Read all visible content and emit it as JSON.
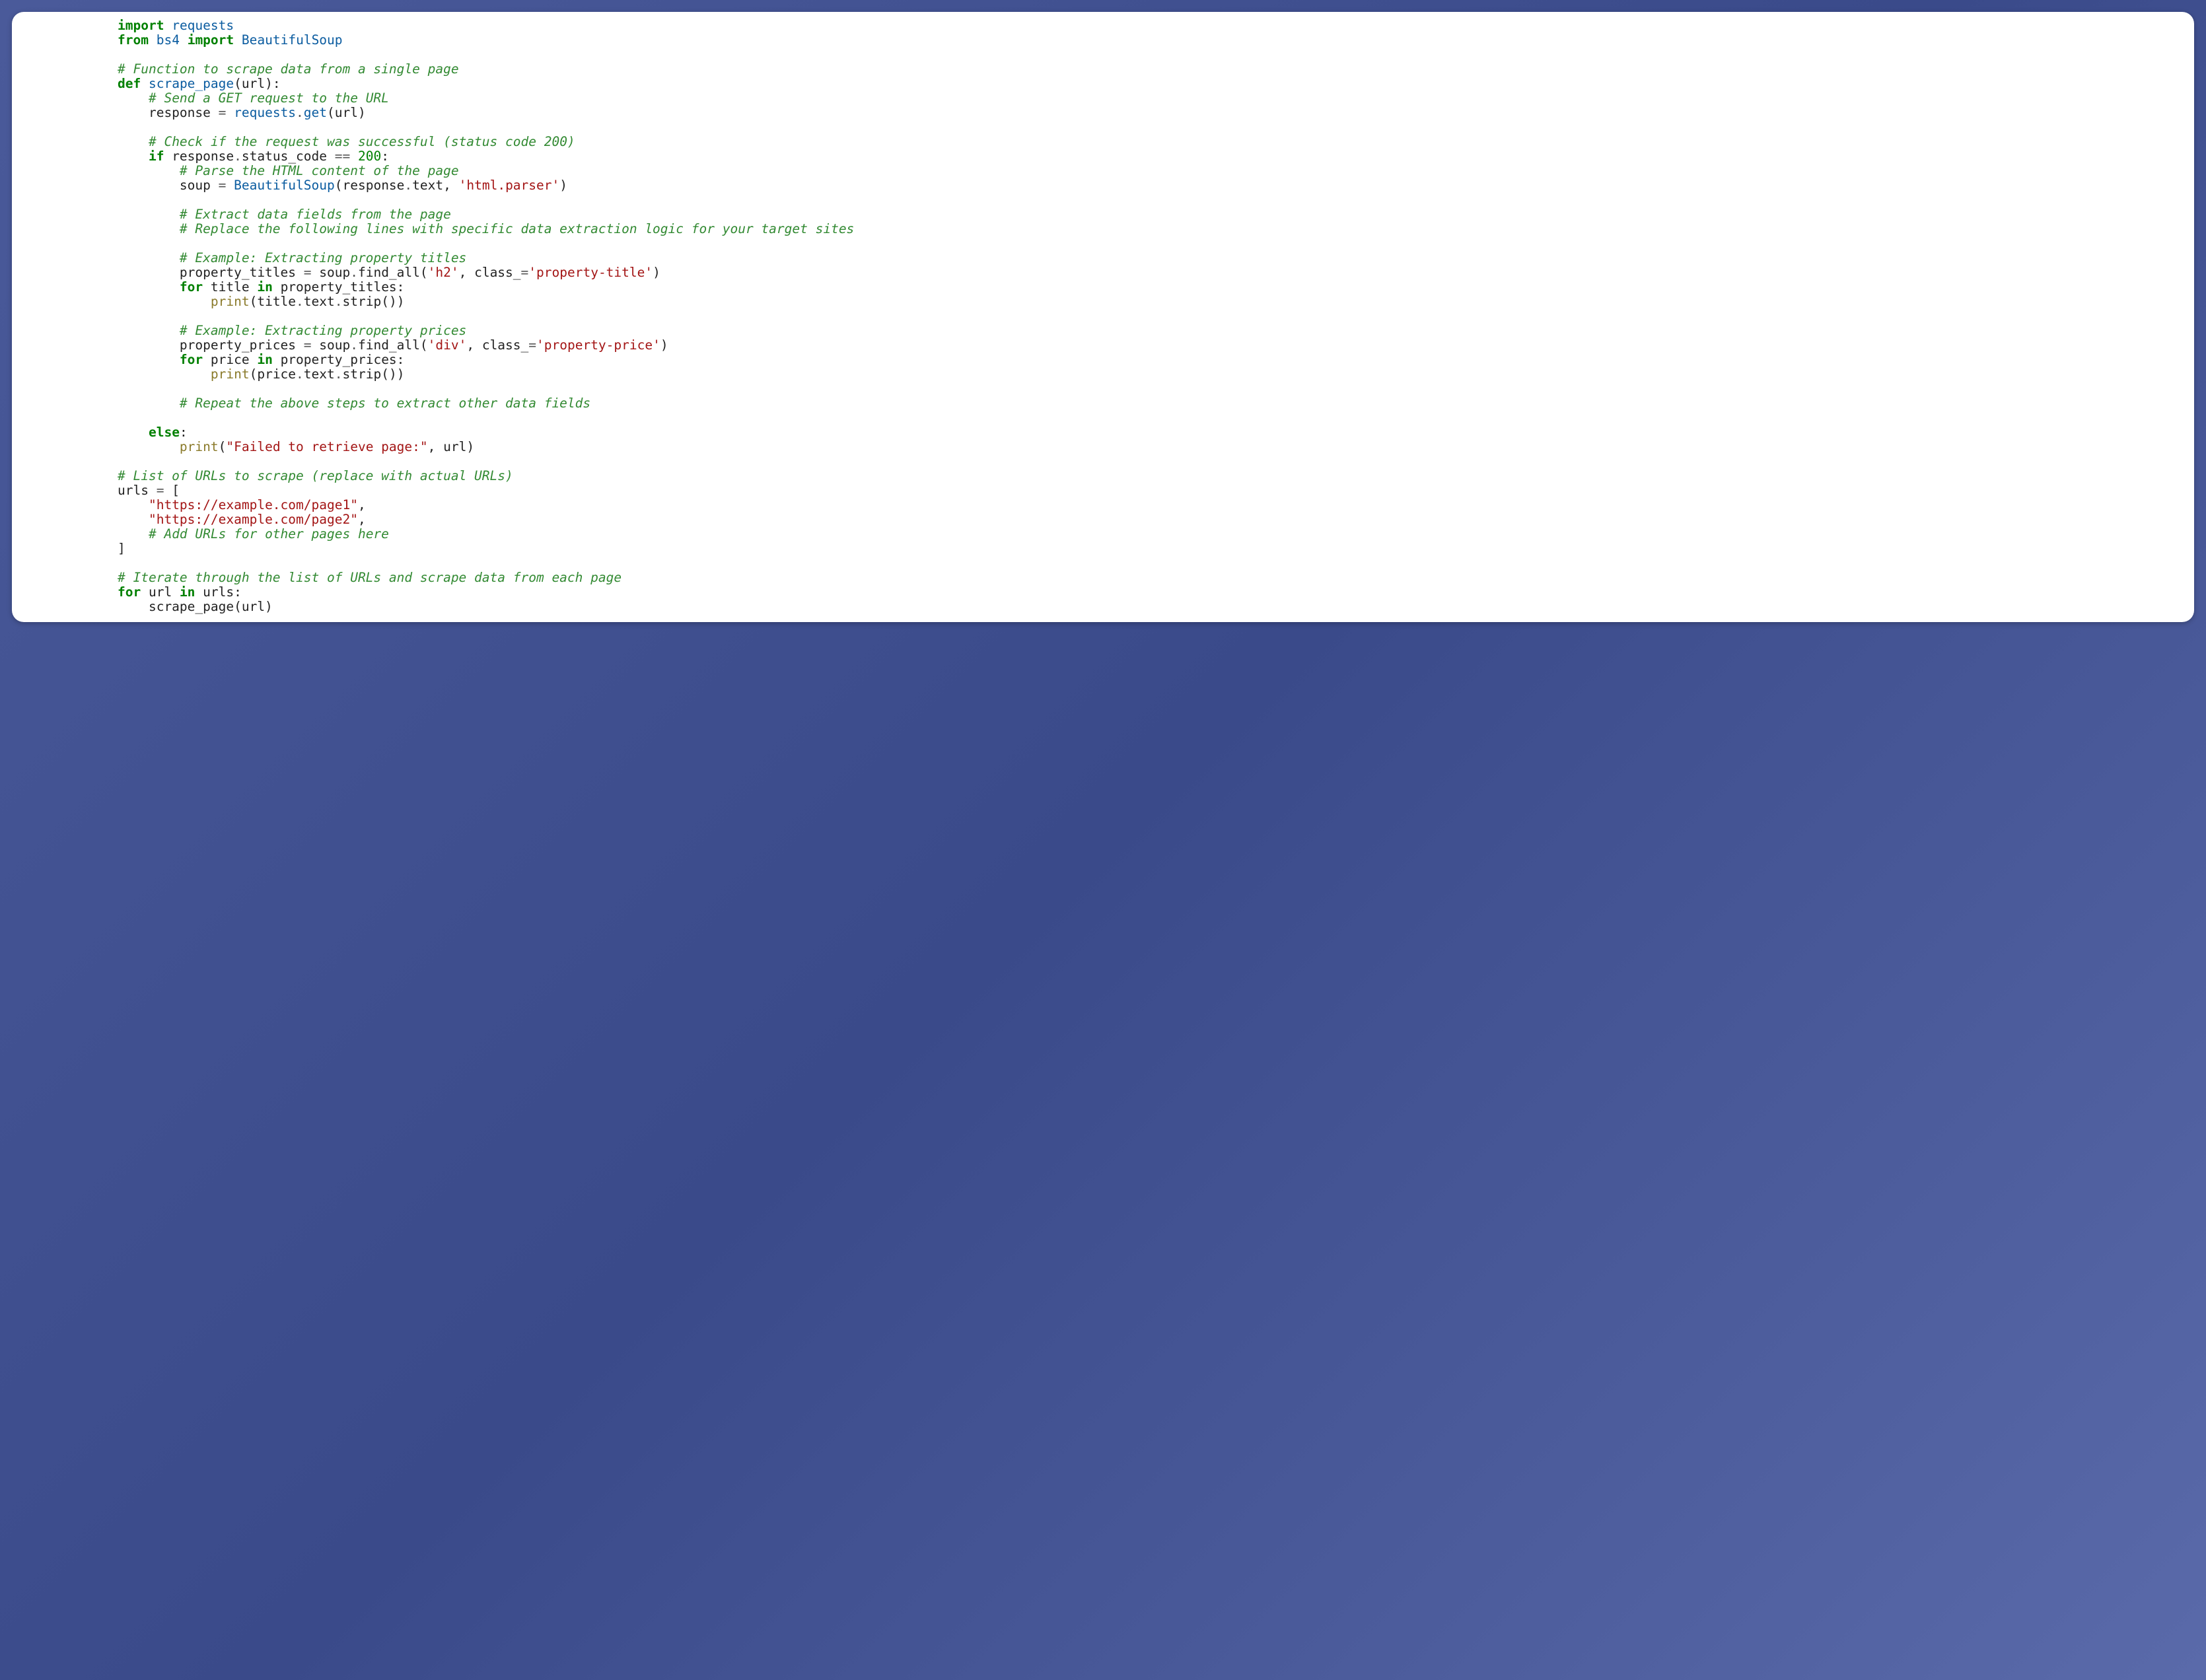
{
  "code": {
    "t": [
      {
        "cls": "kw",
        "txt": "import"
      },
      {
        "cls": "pl",
        "txt": " "
      },
      {
        "cls": "nm",
        "txt": "requests"
      },
      {
        "cls": "pl",
        "txt": "\n"
      },
      {
        "cls": "kw",
        "txt": "from"
      },
      {
        "cls": "pl",
        "txt": " "
      },
      {
        "cls": "nm",
        "txt": "bs4"
      },
      {
        "cls": "pl",
        "txt": " "
      },
      {
        "cls": "kw",
        "txt": "import"
      },
      {
        "cls": "pl",
        "txt": " "
      },
      {
        "cls": "nm",
        "txt": "BeautifulSoup"
      },
      {
        "cls": "pl",
        "txt": "\n\n"
      },
      {
        "cls": "cm",
        "txt": "# Function to scrape data from a single page"
      },
      {
        "cls": "pl",
        "txt": "\n"
      },
      {
        "cls": "kw",
        "txt": "def"
      },
      {
        "cls": "pl",
        "txt": " "
      },
      {
        "cls": "fn",
        "txt": "scrape_page"
      },
      {
        "cls": "pl",
        "txt": "(url):"
      },
      {
        "cls": "pl",
        "txt": "\n    "
      },
      {
        "cls": "cm",
        "txt": "# Send a GET request to the URL"
      },
      {
        "cls": "pl",
        "txt": "\n    response "
      },
      {
        "cls": "op",
        "txt": "="
      },
      {
        "cls": "pl",
        "txt": " "
      },
      {
        "cls": "nm",
        "txt": "requests"
      },
      {
        "cls": "op",
        "txt": "."
      },
      {
        "cls": "nm",
        "txt": "get"
      },
      {
        "cls": "pl",
        "txt": "(url)\n\n    "
      },
      {
        "cls": "cm",
        "txt": "# Check if the request was successful (status code 200)"
      },
      {
        "cls": "pl",
        "txt": "\n    "
      },
      {
        "cls": "kw",
        "txt": "if"
      },
      {
        "cls": "pl",
        "txt": " response"
      },
      {
        "cls": "op",
        "txt": "."
      },
      {
        "cls": "pl",
        "txt": "status_code "
      },
      {
        "cls": "op",
        "txt": "=="
      },
      {
        "cls": "pl",
        "txt": " "
      },
      {
        "cls": "num",
        "txt": "200"
      },
      {
        "cls": "pl",
        "txt": ":\n        "
      },
      {
        "cls": "cm",
        "txt": "# Parse the HTML content of the page"
      },
      {
        "cls": "pl",
        "txt": "\n        soup "
      },
      {
        "cls": "op",
        "txt": "="
      },
      {
        "cls": "pl",
        "txt": " "
      },
      {
        "cls": "nm",
        "txt": "BeautifulSoup"
      },
      {
        "cls": "pl",
        "txt": "(response"
      },
      {
        "cls": "op",
        "txt": "."
      },
      {
        "cls": "pl",
        "txt": "text, "
      },
      {
        "cls": "str",
        "txt": "'html.parser'"
      },
      {
        "cls": "pl",
        "txt": ")\n\n        "
      },
      {
        "cls": "cm",
        "txt": "# Extract data fields from the page"
      },
      {
        "cls": "pl",
        "txt": "\n        "
      },
      {
        "cls": "cm",
        "txt": "# Replace the following lines with specific data extraction logic for your target sites"
      },
      {
        "cls": "pl",
        "txt": "\n\n        "
      },
      {
        "cls": "cm",
        "txt": "# Example: Extracting property titles"
      },
      {
        "cls": "pl",
        "txt": "\n        property_titles "
      },
      {
        "cls": "op",
        "txt": "="
      },
      {
        "cls": "pl",
        "txt": " soup"
      },
      {
        "cls": "op",
        "txt": "."
      },
      {
        "cls": "pl",
        "txt": "find_all("
      },
      {
        "cls": "str",
        "txt": "'h2'"
      },
      {
        "cls": "pl",
        "txt": ", class_"
      },
      {
        "cls": "op",
        "txt": "="
      },
      {
        "cls": "str",
        "txt": "'property-title'"
      },
      {
        "cls": "pl",
        "txt": ")\n        "
      },
      {
        "cls": "kw",
        "txt": "for"
      },
      {
        "cls": "pl",
        "txt": " title "
      },
      {
        "cls": "kw",
        "txt": "in"
      },
      {
        "cls": "pl",
        "txt": " property_titles:\n            "
      },
      {
        "cls": "bi",
        "txt": "print"
      },
      {
        "cls": "pl",
        "txt": "(title"
      },
      {
        "cls": "op",
        "txt": "."
      },
      {
        "cls": "pl",
        "txt": "text"
      },
      {
        "cls": "op",
        "txt": "."
      },
      {
        "cls": "pl",
        "txt": "strip())\n\n        "
      },
      {
        "cls": "cm",
        "txt": "# Example: Extracting property prices"
      },
      {
        "cls": "pl",
        "txt": "\n        property_prices "
      },
      {
        "cls": "op",
        "txt": "="
      },
      {
        "cls": "pl",
        "txt": " soup"
      },
      {
        "cls": "op",
        "txt": "."
      },
      {
        "cls": "pl",
        "txt": "find_all("
      },
      {
        "cls": "str",
        "txt": "'div'"
      },
      {
        "cls": "pl",
        "txt": ", class_"
      },
      {
        "cls": "op",
        "txt": "="
      },
      {
        "cls": "str",
        "txt": "'property-price'"
      },
      {
        "cls": "pl",
        "txt": ")\n        "
      },
      {
        "cls": "kw",
        "txt": "for"
      },
      {
        "cls": "pl",
        "txt": " price "
      },
      {
        "cls": "kw",
        "txt": "in"
      },
      {
        "cls": "pl",
        "txt": " property_prices:\n            "
      },
      {
        "cls": "bi",
        "txt": "print"
      },
      {
        "cls": "pl",
        "txt": "(price"
      },
      {
        "cls": "op",
        "txt": "."
      },
      {
        "cls": "pl",
        "txt": "text"
      },
      {
        "cls": "op",
        "txt": "."
      },
      {
        "cls": "pl",
        "txt": "strip())\n\n        "
      },
      {
        "cls": "cm",
        "txt": "# Repeat the above steps to extract other data fields"
      },
      {
        "cls": "pl",
        "txt": "\n\n    "
      },
      {
        "cls": "kw",
        "txt": "else"
      },
      {
        "cls": "pl",
        "txt": ":\n        "
      },
      {
        "cls": "bi",
        "txt": "print"
      },
      {
        "cls": "pl",
        "txt": "("
      },
      {
        "cls": "str",
        "txt": "\"Failed to retrieve page:\""
      },
      {
        "cls": "pl",
        "txt": ", url)\n\n"
      },
      {
        "cls": "cm",
        "txt": "# List of URLs to scrape (replace with actual URLs)"
      },
      {
        "cls": "pl",
        "txt": "\nurls "
      },
      {
        "cls": "op",
        "txt": "="
      },
      {
        "cls": "pl",
        "txt": " [\n    "
      },
      {
        "cls": "str",
        "txt": "\"https://example.com/page1\""
      },
      {
        "cls": "pl",
        "txt": ",\n    "
      },
      {
        "cls": "str",
        "txt": "\"https://example.com/page2\""
      },
      {
        "cls": "pl",
        "txt": ",\n    "
      },
      {
        "cls": "cm",
        "txt": "# Add URLs for other pages here"
      },
      {
        "cls": "pl",
        "txt": "\n]\n\n"
      },
      {
        "cls": "cm",
        "txt": "# Iterate through the list of URLs and scrape data from each page"
      },
      {
        "cls": "pl",
        "txt": "\n"
      },
      {
        "cls": "kw",
        "txt": "for"
      },
      {
        "cls": "pl",
        "txt": " url "
      },
      {
        "cls": "kw",
        "txt": "in"
      },
      {
        "cls": "pl",
        "txt": " urls:\n    scrape_page(url)"
      }
    ]
  }
}
